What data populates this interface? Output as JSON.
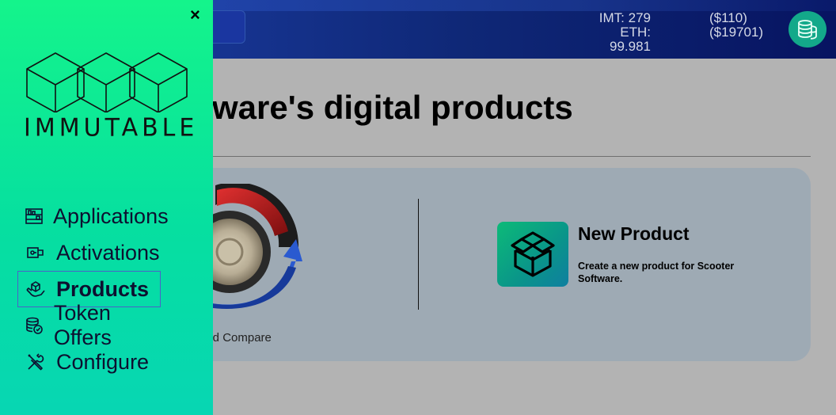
{
  "header": {
    "imt_balance": "IMT: 279",
    "imt_usd": "($110)",
    "eth_balance": "ETH: 99.981",
    "eth_usd": "($19701)",
    "wallet_icon": "coins-icon"
  },
  "main": {
    "title": "ftware's digital products",
    "products": [
      {
        "name": "ond Compare",
        "icon": "product-image"
      }
    ],
    "new_product": {
      "title": "New Product",
      "description": "Create a new product for Scooter Software.",
      "icon": "open-box-icon"
    }
  },
  "sidebar": {
    "close_label": "×",
    "logo_text": "IMMUTABLE",
    "items": [
      {
        "label": "Applications",
        "icon": "shelves-icon",
        "active": false
      },
      {
        "label": "Activations",
        "icon": "key-card-icon",
        "active": false
      },
      {
        "label": "Products",
        "icon": "hand-box-icon",
        "active": true
      },
      {
        "label": "Token Offers",
        "icon": "coin-stack-icon",
        "active": false
      },
      {
        "label": "Configure",
        "icon": "tools-icon",
        "active": false
      }
    ]
  },
  "colors": {
    "sidebar_top": "#14f48b",
    "sidebar_bottom": "#07d6b3",
    "header": "#0f2877",
    "card": "#9eaab4"
  }
}
